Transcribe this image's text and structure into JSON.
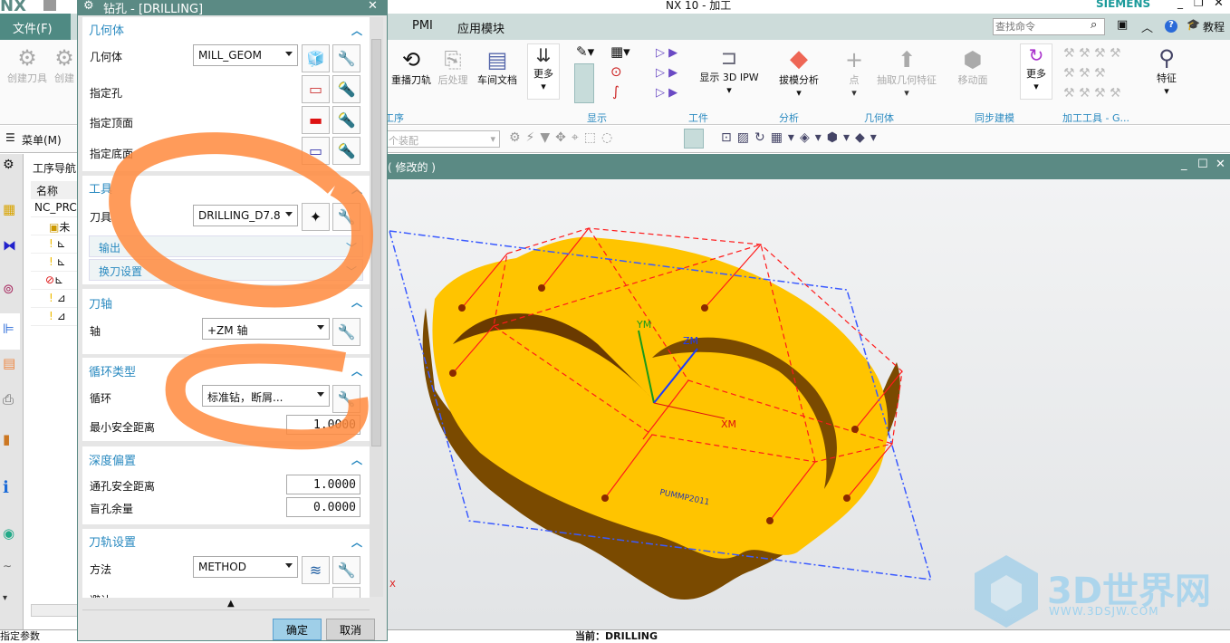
{
  "app": {
    "logo": "NX",
    "title": "NX 10 - 加工",
    "brand": "SIEMENS"
  },
  "tabs": {
    "file": "文件(F)",
    "items": [
      "PMI",
      "应用模块"
    ]
  },
  "search": {
    "placeholder": "查找命令",
    "tutorial": "教程"
  },
  "ribbon": {
    "left_buttons": [
      "创建刀具",
      "创建"
    ],
    "buttons": [
      {
        "label": "重播刀轨",
        "disabled": false
      },
      {
        "label": "后处理",
        "disabled": true
      },
      {
        "label": "车间文档",
        "disabled": false
      },
      {
        "label": "更多",
        "disabled": false
      },
      {
        "label": "显示 3D IPW",
        "disabled": false
      },
      {
        "label": "拔模分析",
        "disabled": false
      },
      {
        "label": "点",
        "disabled": true
      },
      {
        "label": "抽取几何特征",
        "disabled": true
      },
      {
        "label": "移动面",
        "disabled": true
      },
      {
        "label": "更多",
        "disabled": false
      },
      {
        "label": "特征",
        "disabled": false
      }
    ],
    "groups": [
      "工序",
      "显示",
      "工件",
      "分析",
      "几何体",
      "同步建模",
      "加工工具 - G..."
    ]
  },
  "toolbar": {
    "menu": "菜单(M)",
    "assembly_filter": "个装配"
  },
  "viewport": {
    "title": "( 修改的 )",
    "labels": {
      "ym": "YM",
      "zm": "ZM",
      "xm": "XM",
      "engraving": "PUMMP2011",
      "x_axis": "X"
    },
    "watermark": {
      "name": "3D世界网",
      "url": "WWW.3DSJW.COM"
    }
  },
  "navigator": {
    "title": "工序导航",
    "column": "名称",
    "root": "NC_PRC",
    "rows": [
      "未",
      "",
      "",
      "",
      "",
      ""
    ]
  },
  "status": {
    "left": "指定参数",
    "center": "当前：DRILLING"
  },
  "dialog": {
    "title": "钻孔 - [DRILLING]",
    "geometry": {
      "header": "几何体",
      "geom_label": "几何体",
      "geom_value": "MILL_GEOM",
      "hole": "指定孔",
      "top": "指定顶面",
      "bottom": "指定底面"
    },
    "tool": {
      "header": "工具",
      "tool_label": "刀具",
      "tool_value": "DRILLING_D7.8",
      "output": "输出",
      "toolchange": "换刀设置"
    },
    "axis": {
      "header": "刀轴",
      "axis_label": "轴",
      "axis_value": "+ZM 轴"
    },
    "cycle": {
      "header": "循环类型",
      "cycle_label": "循环",
      "cycle_value": "标准钻，断屑...",
      "min_clear_label": "最小安全距离",
      "min_clear_value": "1.0000"
    },
    "depth": {
      "header": "深度偏置",
      "through_label": "通孔安全距离",
      "through_value": "1.0000",
      "blind_label": "盲孔余量",
      "blind_value": "0.0000"
    },
    "path": {
      "header": "刀轨设置",
      "method_label": "方法",
      "method_value": "METHOD",
      "next_label": "避让"
    },
    "ok": "确定",
    "cancel": "取消"
  },
  "colors": {
    "teal": "#5b8a84",
    "part_top": "#ffc400",
    "part_side": "#7a4a00",
    "accent_blue": "#2a8ac0",
    "markup": "#ff8a3d"
  }
}
